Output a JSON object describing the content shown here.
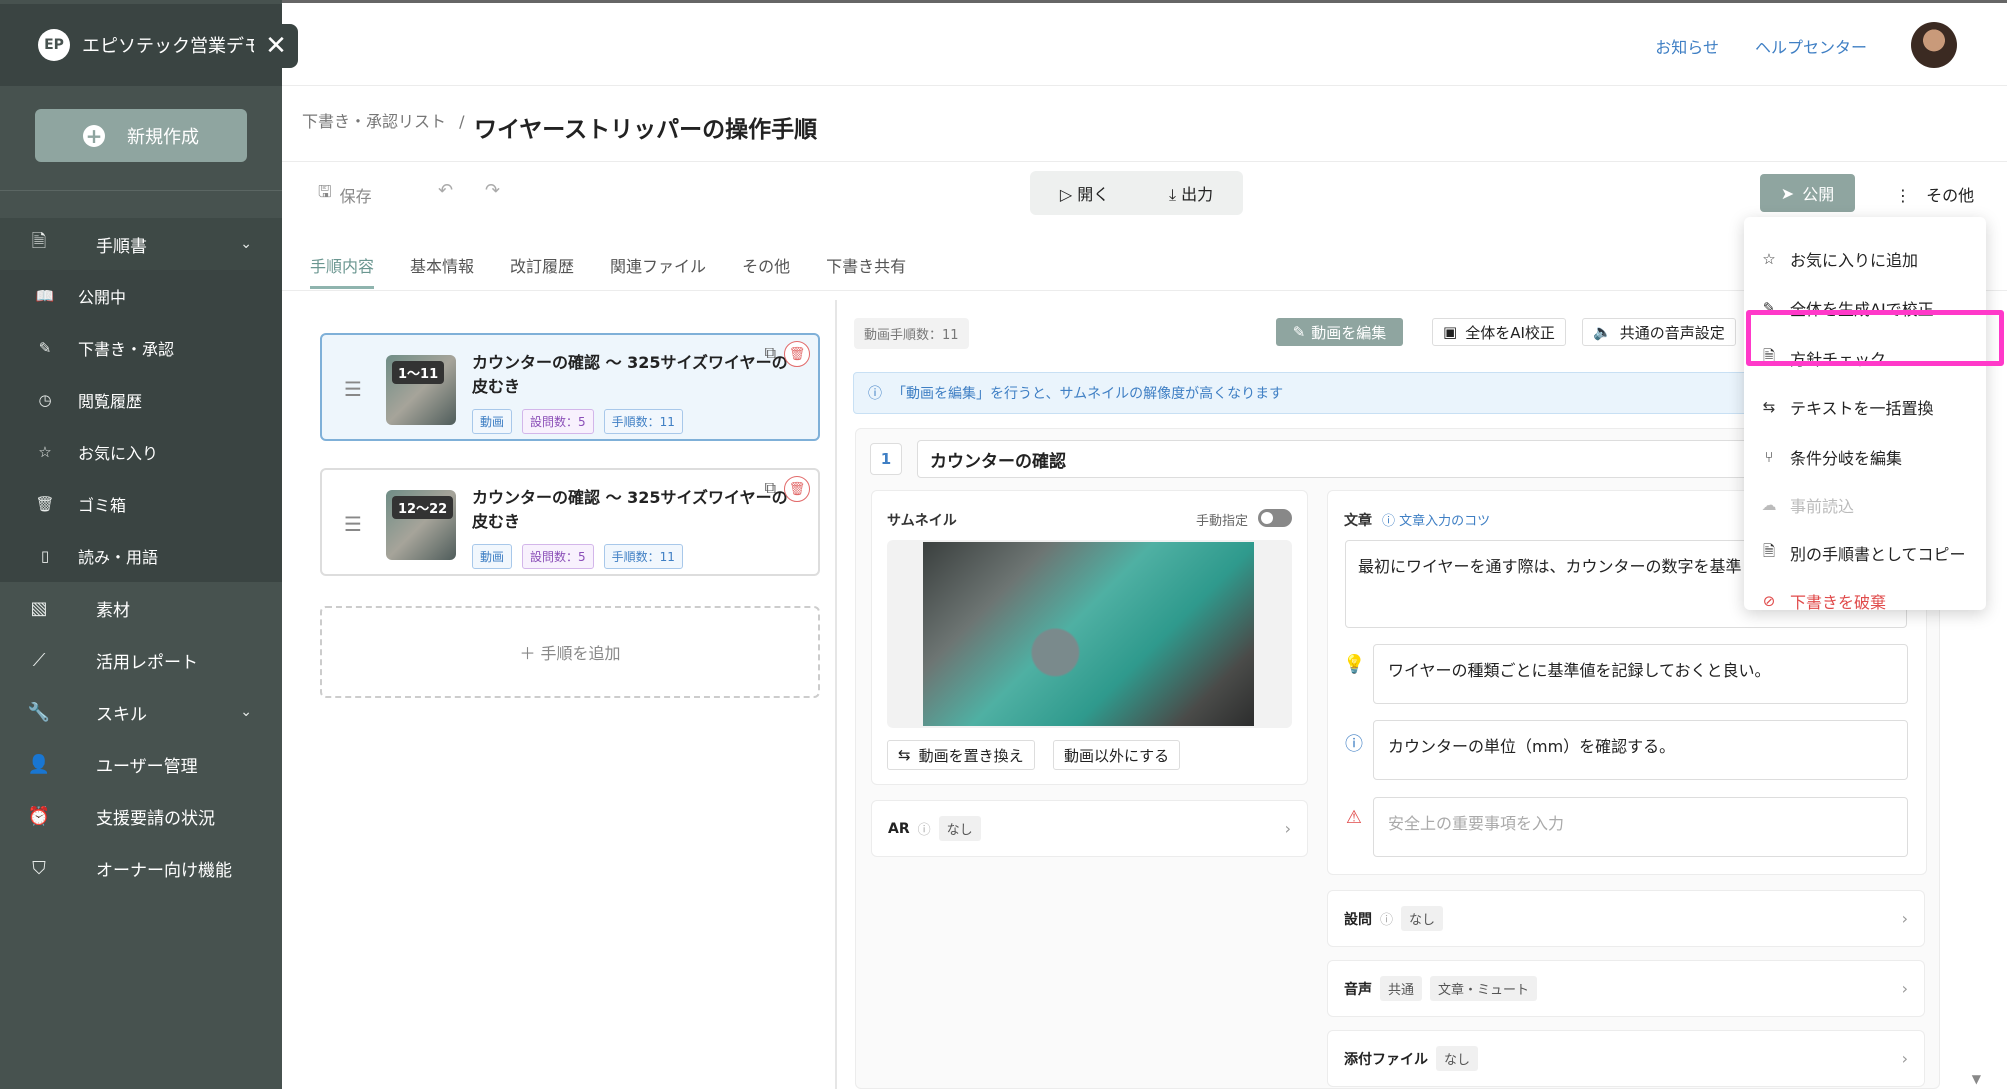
{
  "workspace": {
    "logo": "EP",
    "name": "エピソテック営業デモ",
    "close": "✕"
  },
  "sidebar": {
    "new_button": "新規作成",
    "items": [
      {
        "label": "手順書",
        "icon": "document-icon",
        "glyph": "🗎",
        "expandable": true
      },
      {
        "label": "公開中",
        "icon": "book-icon",
        "glyph": "📖"
      },
      {
        "label": "下書き・承認",
        "icon": "pen-icon",
        "glyph": "✎"
      },
      {
        "label": "閲覧履歴",
        "icon": "history-icon",
        "glyph": "◷"
      },
      {
        "label": "お気に入り",
        "icon": "star-icon",
        "glyph": "☆"
      },
      {
        "label": "ゴミ箱",
        "icon": "trash-icon",
        "glyph": "🗑"
      },
      {
        "label": "読み・用語",
        "icon": "glossary-icon",
        "glyph": "▯"
      },
      {
        "label": "素材",
        "icon": "image-icon",
        "glyph": "▧"
      },
      {
        "label": "活用レポート",
        "icon": "chart-line-icon",
        "glyph": "⟋"
      },
      {
        "label": "スキル",
        "icon": "wrench-icon",
        "glyph": "🔧",
        "expandable": true
      },
      {
        "label": "ユーザー管理",
        "icon": "user-icon",
        "glyph": "👤"
      },
      {
        "label": "支援要請の状況",
        "icon": "alarm-icon",
        "glyph": "⏰"
      },
      {
        "label": "オーナー向け機能",
        "icon": "shield-icon",
        "glyph": "⛉"
      }
    ]
  },
  "header": {
    "news": "お知らせ",
    "help": "ヘルプセンター"
  },
  "breadcrumb": {
    "parent": "下書き・承認リスト",
    "separator": "/",
    "title": "ワイヤーストリッパーの操作手順"
  },
  "toolbar": {
    "save": "保存",
    "open": "開く",
    "export": "出力",
    "publish": "公開",
    "other": "その他"
  },
  "tabs": [
    "手順内容",
    "基本情報",
    "改訂履歴",
    "関連ファイル",
    "その他",
    "下書き共有"
  ],
  "steps": [
    {
      "range": "1～11",
      "title": "カウンターの確認 ～ 325サイズワイヤーの皮むき",
      "type": "動画",
      "questions": "設問数：5",
      "count": "手順数：11"
    },
    {
      "range": "12～22",
      "title": "カウンターの確認 ～ 325サイズワイヤーの皮むき",
      "type": "動画",
      "questions": "設問数：5",
      "count": "手順数：11"
    }
  ],
  "add_step": "＋ 手順を追加",
  "editor": {
    "video_step_count": "動画手順数：11",
    "edit_video": "動画を編集",
    "ai_proofread_all": "全体をAI校正",
    "common_audio": "共通の音声設定",
    "banner": "「動画を編集」を行うと、サムネイルの解像度が高くなります",
    "step_number": "1",
    "step_name": "カウンターの確認",
    "thumbnail_label": "サムネイル",
    "manual_label": "手動指定",
    "replace_video": "動画を置き換え",
    "non_video": "動画以外にする",
    "ar_label": "AR",
    "ar_value": "なし",
    "text_label": "文章",
    "text_tip": "文章入力のコツ",
    "text_value": "最初にワイヤーを通す際は、カウンターの数字を基準",
    "hint": "ワイヤーの種類ごとに基準値を記録しておくと良い。",
    "caution": "カウンターの単位（mm）を確認する。",
    "warning_placeholder": "安全上の重要事項を入力",
    "question_label": "設問",
    "question_value": "なし",
    "audio_label": "音声",
    "audio_value1": "共通",
    "audio_value2": "文章・ミュート",
    "attach_label": "添付ファイル",
    "attach_value": "なし"
  },
  "menu": {
    "items": [
      {
        "label": "お気に入りに追加",
        "icon": "star-icon",
        "glyph": "☆"
      },
      {
        "label": "全体を生成AIで校正",
        "icon": "pen-icon",
        "glyph": "✎"
      },
      {
        "label": "方針チェック",
        "icon": "document-check-icon",
        "glyph": "🗎"
      },
      {
        "label": "テキストを一括置換",
        "icon": "swap-icon",
        "glyph": "⇆"
      },
      {
        "label": "条件分岐を編集",
        "icon": "branch-icon",
        "glyph": "⑂"
      },
      {
        "label": "事前読込",
        "icon": "cloud-icon",
        "glyph": "☁"
      },
      {
        "label": "別の手順書としてコピー",
        "icon": "copy-doc-icon",
        "glyph": "🗎"
      },
      {
        "label": "下書きを破棄",
        "icon": "ban-icon",
        "glyph": "⊘"
      }
    ]
  },
  "colors": {
    "sidebar": "#47524f",
    "accent": "#8fa5a0",
    "link": "#3f7fc4",
    "highlight": "#ff39c9",
    "danger": "#e04b4b"
  }
}
